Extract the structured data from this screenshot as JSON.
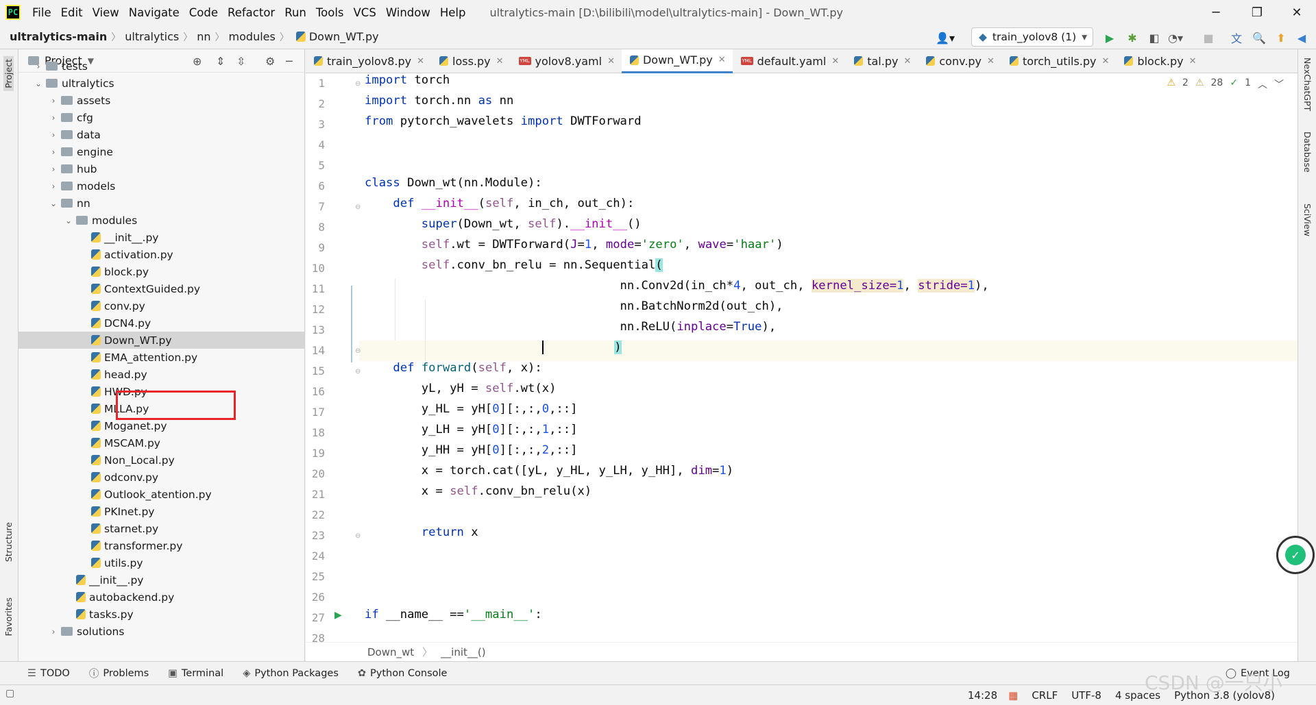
{
  "menubar": {
    "items": [
      "File",
      "Edit",
      "View",
      "Navigate",
      "Code",
      "Refactor",
      "Run",
      "Tools",
      "VCS",
      "Window",
      "Help"
    ],
    "window_title": "ultralytics-main [D:\\bilibili\\model\\ultralytics-main] - Down_WT.py"
  },
  "navbar": {
    "crumbs": [
      "ultralytics-main",
      "ultralytics",
      "nn",
      "modules",
      "Down_WT.py"
    ],
    "run_config": "train_yolov8 (1)"
  },
  "project": {
    "title": "Project",
    "tree": [
      {
        "label": "tests",
        "type": "folder",
        "depth": 1,
        "chevron": "›"
      },
      {
        "label": "ultralytics",
        "type": "folder",
        "depth": 1,
        "chevron": "⌄"
      },
      {
        "label": "assets",
        "type": "folder",
        "depth": 2,
        "chevron": "›"
      },
      {
        "label": "cfg",
        "type": "folder",
        "depth": 2,
        "chevron": "›"
      },
      {
        "label": "data",
        "type": "folder",
        "depth": 2,
        "chevron": "›"
      },
      {
        "label": "engine",
        "type": "folder",
        "depth": 2,
        "chevron": "›"
      },
      {
        "label": "hub",
        "type": "folder",
        "depth": 2,
        "chevron": "›"
      },
      {
        "label": "models",
        "type": "folder",
        "depth": 2,
        "chevron": "›"
      },
      {
        "label": "nn",
        "type": "folder",
        "depth": 2,
        "chevron": "⌄"
      },
      {
        "label": "modules",
        "type": "folder",
        "depth": 3,
        "chevron": "⌄"
      },
      {
        "label": "__init__.py",
        "type": "py",
        "depth": 4
      },
      {
        "label": "activation.py",
        "type": "py",
        "depth": 4
      },
      {
        "label": "block.py",
        "type": "py",
        "depth": 4
      },
      {
        "label": "ContextGuided.py",
        "type": "py",
        "depth": 4
      },
      {
        "label": "conv.py",
        "type": "py",
        "depth": 4
      },
      {
        "label": "DCN4.py",
        "type": "py",
        "depth": 4
      },
      {
        "label": "Down_WT.py",
        "type": "py",
        "depth": 4,
        "selected": true
      },
      {
        "label": "EMA_attention.py",
        "type": "py",
        "depth": 4
      },
      {
        "label": "head.py",
        "type": "py",
        "depth": 4
      },
      {
        "label": "HWD.py",
        "type": "py",
        "depth": 4
      },
      {
        "label": "MLLA.py",
        "type": "py",
        "depth": 4
      },
      {
        "label": "Moganet.py",
        "type": "py",
        "depth": 4
      },
      {
        "label": "MSCAM.py",
        "type": "py",
        "depth": 4
      },
      {
        "label": "Non_Local.py",
        "type": "py",
        "depth": 4
      },
      {
        "label": "odconv.py",
        "type": "py",
        "depth": 4
      },
      {
        "label": "Outlook_atention.py",
        "type": "py",
        "depth": 4
      },
      {
        "label": "PKInet.py",
        "type": "py",
        "depth": 4
      },
      {
        "label": "starnet.py",
        "type": "py",
        "depth": 4
      },
      {
        "label": "transformer.py",
        "type": "py",
        "depth": 4
      },
      {
        "label": "utils.py",
        "type": "py",
        "depth": 4
      },
      {
        "label": "__init__.py",
        "type": "py",
        "depth": 3
      },
      {
        "label": "autobackend.py",
        "type": "py",
        "depth": 3
      },
      {
        "label": "tasks.py",
        "type": "py",
        "depth": 3
      },
      {
        "label": "solutions",
        "type": "folder",
        "depth": 2,
        "chevron": "›"
      }
    ]
  },
  "tabs": [
    {
      "label": "train_yolov8.py",
      "kind": "py"
    },
    {
      "label": "loss.py",
      "kind": "py"
    },
    {
      "label": "yolov8.yaml",
      "kind": "yml"
    },
    {
      "label": "Down_WT.py",
      "kind": "py",
      "active": true
    },
    {
      "label": "default.yaml",
      "kind": "yml"
    },
    {
      "label": "tal.py",
      "kind": "py"
    },
    {
      "label": "conv.py",
      "kind": "py"
    },
    {
      "label": "torch_utils.py",
      "kind": "py"
    },
    {
      "label": "block.py",
      "kind": "py"
    }
  ],
  "editor": {
    "inspections": {
      "warnings": "2",
      "weak_warnings": "28",
      "typos": "1"
    },
    "lines": [
      "1",
      "2",
      "3",
      "4",
      "5",
      "6",
      "7",
      "8",
      "9",
      "10",
      "11",
      "12",
      "13",
      "14",
      "15",
      "16",
      "17",
      "18",
      "19",
      "20",
      "21",
      "22",
      "23",
      "24",
      "25",
      "26",
      "27",
      "28"
    ]
  },
  "code_breadcrumb": [
    "Down_wt",
    "__init__()"
  ],
  "side_tools": {
    "left": [
      "Project",
      "Structure",
      "Favorites"
    ],
    "right": [
      "NexChatGPT",
      "Database",
      "SciView"
    ]
  },
  "bottom_tools": [
    "TODO",
    "Problems",
    "Terminal",
    "Python Packages",
    "Python Console",
    "Event Log"
  ],
  "status": {
    "position": "14:28",
    "line_sep": "CRLF",
    "encoding": "UTF-8",
    "indent": "4 spaces",
    "interpreter": "Python 3.8 (yolov8)"
  },
  "watermark": "CSDN @一只小"
}
